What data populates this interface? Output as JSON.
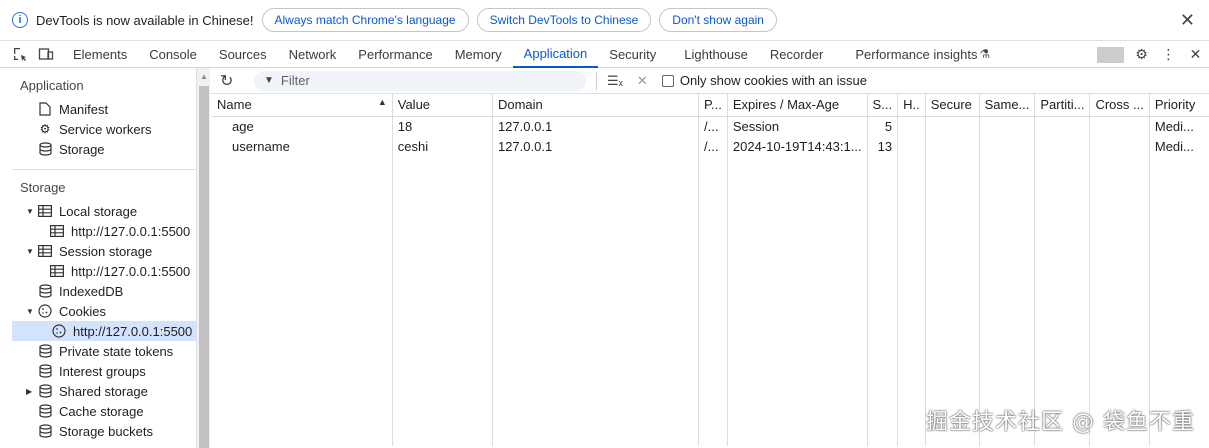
{
  "infobar": {
    "message": "DevTools is now available in Chinese!",
    "btn_match": "Always match Chrome's language",
    "btn_switch": "Switch DevTools to Chinese",
    "btn_dont_show": "Don't show again"
  },
  "tabs": [
    "Elements",
    "Console",
    "Sources",
    "Network",
    "Performance",
    "Memory",
    "Application",
    "Security",
    "Lighthouse",
    "Recorder",
    "Performance insights"
  ],
  "sidebar": {
    "application_title": "Application",
    "app_items": [
      "Manifest",
      "Service workers",
      "Storage"
    ],
    "storage_title": "Storage",
    "local_storage": "Local storage",
    "local_storage_child": "http://127.0.0.1:5500",
    "session_storage": "Session storage",
    "session_storage_child": "http://127.0.0.1:5500",
    "indexeddb": "IndexedDB",
    "cookies": "Cookies",
    "cookies_child": "http://127.0.0.1:5500",
    "private_state": "Private state tokens",
    "interest_groups": "Interest groups",
    "shared_storage": "Shared storage",
    "cache_storage": "Cache storage",
    "storage_buckets": "Storage buckets"
  },
  "toolbar": {
    "filter_placeholder": "Filter",
    "only_issue_label": "Only show cookies with an issue"
  },
  "table": {
    "headers": [
      "Name",
      "Value",
      "Domain",
      "P...",
      "Expires / Max-Age",
      "S...",
      "H..",
      "Secure",
      "Same...",
      "Partiti...",
      "Cross ...",
      "Priority"
    ],
    "rows": [
      [
        "age",
        "18",
        "127.0.0.1",
        "/...",
        "Session",
        "5",
        "",
        "",
        "",
        "",
        "",
        "Medi..."
      ],
      [
        "username",
        "ceshi",
        "127.0.0.1",
        "/...",
        "2024-10-19T14:43:1...",
        "13",
        "",
        "",
        "",
        "",
        "",
        "Medi..."
      ]
    ]
  },
  "watermark": "掘金技术社区 @ 袋鱼不重"
}
